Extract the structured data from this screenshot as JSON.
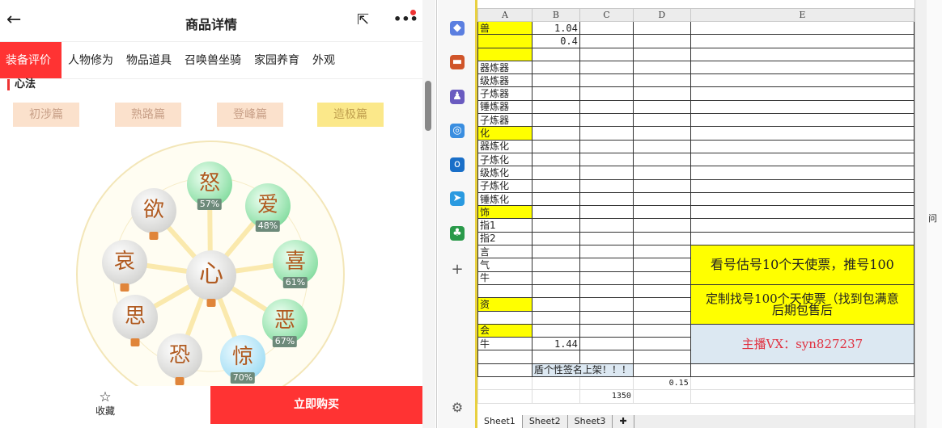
{
  "app": {
    "title": "商品详情",
    "tabs": [
      "装备评价",
      "人物修为",
      "物品道具",
      "召唤兽坐骑",
      "家园养育",
      "外观"
    ],
    "section": "心法",
    "levels": [
      "初涉篇",
      "熟路篇",
      "登峰篇",
      "造极篇"
    ],
    "center": "心",
    "nodes": [
      {
        "char": "怒",
        "pct": "57%",
        "state": "on"
      },
      {
        "char": "爱",
        "pct": "48%",
        "state": "on"
      },
      {
        "char": "喜",
        "pct": "61%",
        "state": "on"
      },
      {
        "char": "恶",
        "pct": "67%",
        "state": "on"
      },
      {
        "char": "惊",
        "pct": "70%",
        "state": "blue"
      },
      {
        "char": "恐",
        "pct": null,
        "state": "locked"
      },
      {
        "char": "思",
        "pct": null,
        "state": "locked"
      },
      {
        "char": "哀",
        "pct": null,
        "state": "locked"
      },
      {
        "char": "欲",
        "pct": null,
        "state": "locked"
      }
    ],
    "fav": "收藏",
    "buy": "立即购买"
  },
  "sheet": {
    "columns": [
      "A",
      "B",
      "C",
      "D",
      "E"
    ],
    "rows": [
      [
        "兽",
        "1.04"
      ],
      [
        "",
        "0.4"
      ],
      [
        ""
      ],
      [
        "器炼器"
      ],
      [
        "级炼器"
      ],
      [
        "子炼器"
      ],
      [
        "锤炼器"
      ],
      [
        "子炼器"
      ],
      [
        "化"
      ],
      [
        "器炼化"
      ],
      [
        "子炼化"
      ],
      [
        "级炼化"
      ],
      [
        "子炼化"
      ],
      [
        "锤炼化"
      ],
      [
        "饰"
      ],
      [
        "指1"
      ],
      [
        "指2"
      ],
      [
        "言"
      ],
      [
        "气"
      ],
      [
        "牛"
      ],
      [
        ""
      ],
      [
        "资"
      ],
      [
        ""
      ],
      [
        "会"
      ],
      [
        "牛",
        "1.44"
      ],
      [
        ""
      ]
    ],
    "e1": "看号估号10个天使票，推号100",
    "e2": "定制找号100个天使票（找到包满意",
    "e2b": "后期包售后",
    "e3": "主播VX：syn827237",
    "banner": "盾个性签名上架！！！",
    "d_val": "0.15",
    "c_val": "1350",
    "tabs": [
      "Sheet1",
      "Sheet2",
      "Sheet3"
    ]
  },
  "right": {
    "label": "问"
  }
}
